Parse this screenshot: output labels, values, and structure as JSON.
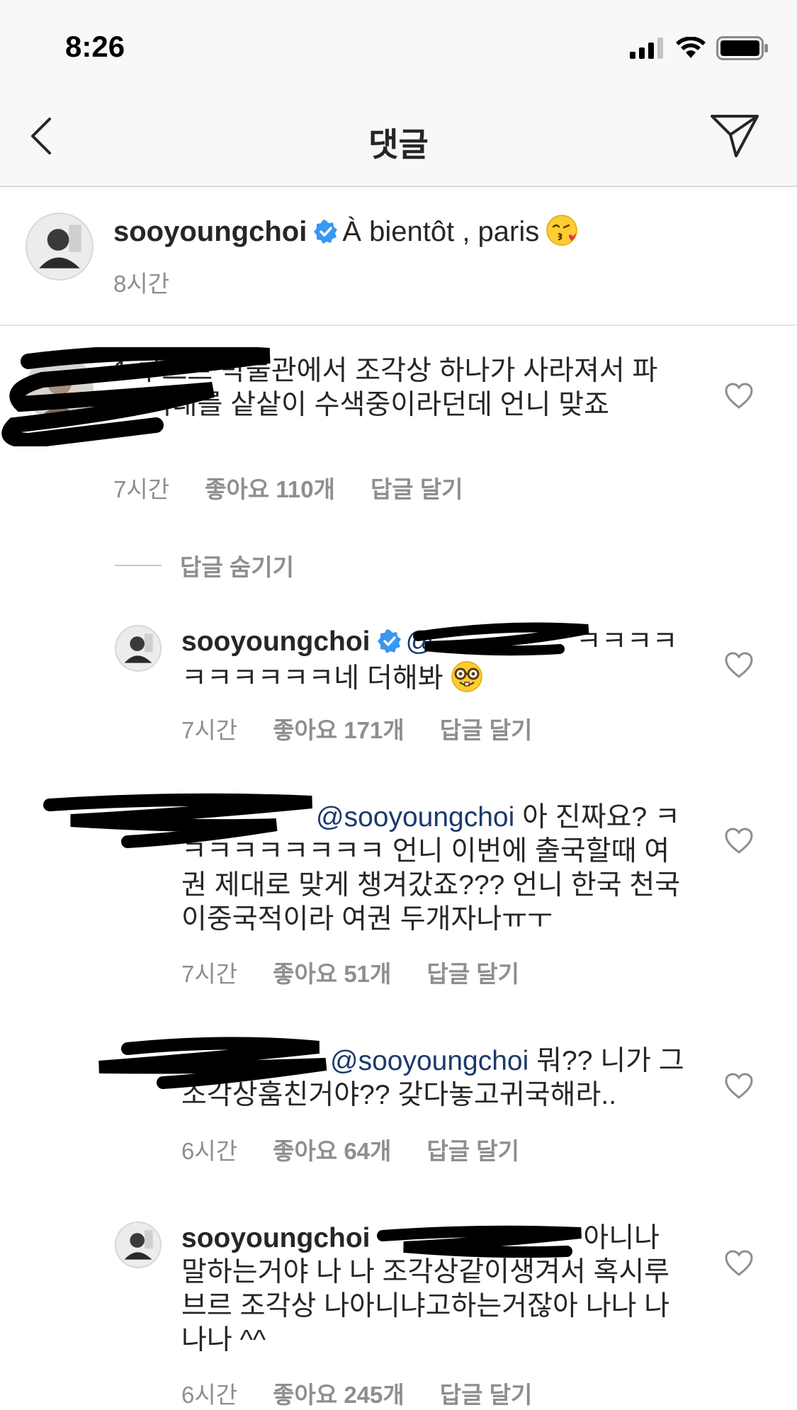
{
  "status_bar": {
    "time": "8:26"
  },
  "nav": {
    "title": "댓글"
  },
  "caption": {
    "username": "sooyoungchoi",
    "text": "À bientôt , paris",
    "emoji": "kissing-face-with-heart",
    "time": "8시간"
  },
  "comments": [
    {
      "username": "",
      "text_before": "1 루브르 박물관에서 조각상 하나가 사라져서 파리 시내를 샅샅이 수색중이라던데 언니 맞죠",
      "time": "7시간",
      "likes": "좋아요 110개",
      "reply": "답글 달기"
    }
  ],
  "hide_replies": "답글 숨기기",
  "replies": [
    {
      "username": "sooyoungchoi",
      "mention": "@",
      "text": "ㅋㅋㅋㅋㅋㅋㅋㅋㅋㅋ네 더해봐",
      "emoji": "nerd-face",
      "time": "7시간",
      "likes": "좋아요 171개",
      "reply": "답글 달기"
    },
    {
      "username": "",
      "mention": "@sooyoungchoi",
      "text": "아 진짜요? ㅋㅋㅋㅋㅋㅋㅋㅋㅋ 언니 이번에 출국할때 여권 제대로 맞게 챙겨갔죠??? 언니 한국 천국 이중국적이라 여권 두개자나ㅠㅜ",
      "time": "7시간",
      "likes": "좋아요 51개",
      "reply": "답글 달기"
    },
    {
      "username": "",
      "mention": "@sooyoungchoi",
      "text": "뭐?? 니가 그조각상훔친거야?? 갖다놓고귀국해라..",
      "time": "6시간",
      "likes": "좋아요 64개",
      "reply": "답글 달기"
    },
    {
      "username": "sooyoungchoi",
      "mention": "",
      "text": "아니나 말하는거야 나 나 조각상같이생겨서 혹시루브르 조각상 나아니냐고하는거잖아 나나 나나나 ^^",
      "time": "6시간",
      "likes": "좋아요 245개",
      "reply": "답글 달기"
    }
  ]
}
